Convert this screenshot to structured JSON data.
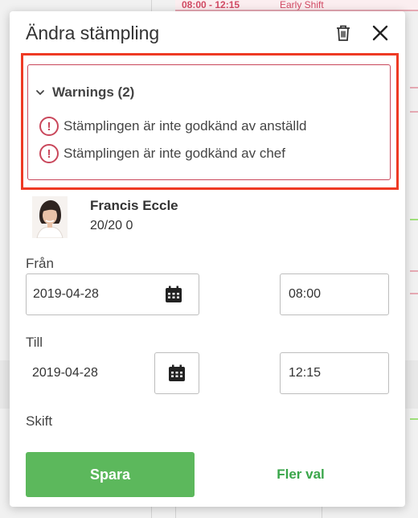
{
  "background": {
    "shift_time": "08:00 - 12:15",
    "shift_name": "Early Shift"
  },
  "modal": {
    "title": "Ändra stämpling",
    "trash_icon": "trash-icon",
    "close_icon": "close-icon"
  },
  "warnings": {
    "header": "Warnings (2)",
    "items": [
      "Stämplingen är inte godkänd av anställd",
      "Stämplingen är inte godkänd av chef"
    ],
    "color": "#c9475b",
    "highlight_color": "#ee3a24"
  },
  "employee": {
    "name": "Francis Eccle",
    "sub": "20/20 0"
  },
  "from": {
    "label": "Från",
    "date": "2019-04-28",
    "time": "08:00"
  },
  "to": {
    "label": "Till",
    "date": "2019-04-28",
    "time": "12:15"
  },
  "shift": {
    "label": "Skift"
  },
  "actions": {
    "save": "Spara",
    "more": "Fler val",
    "save_color": "#5cb85c",
    "more_color": "#3aa64a"
  }
}
